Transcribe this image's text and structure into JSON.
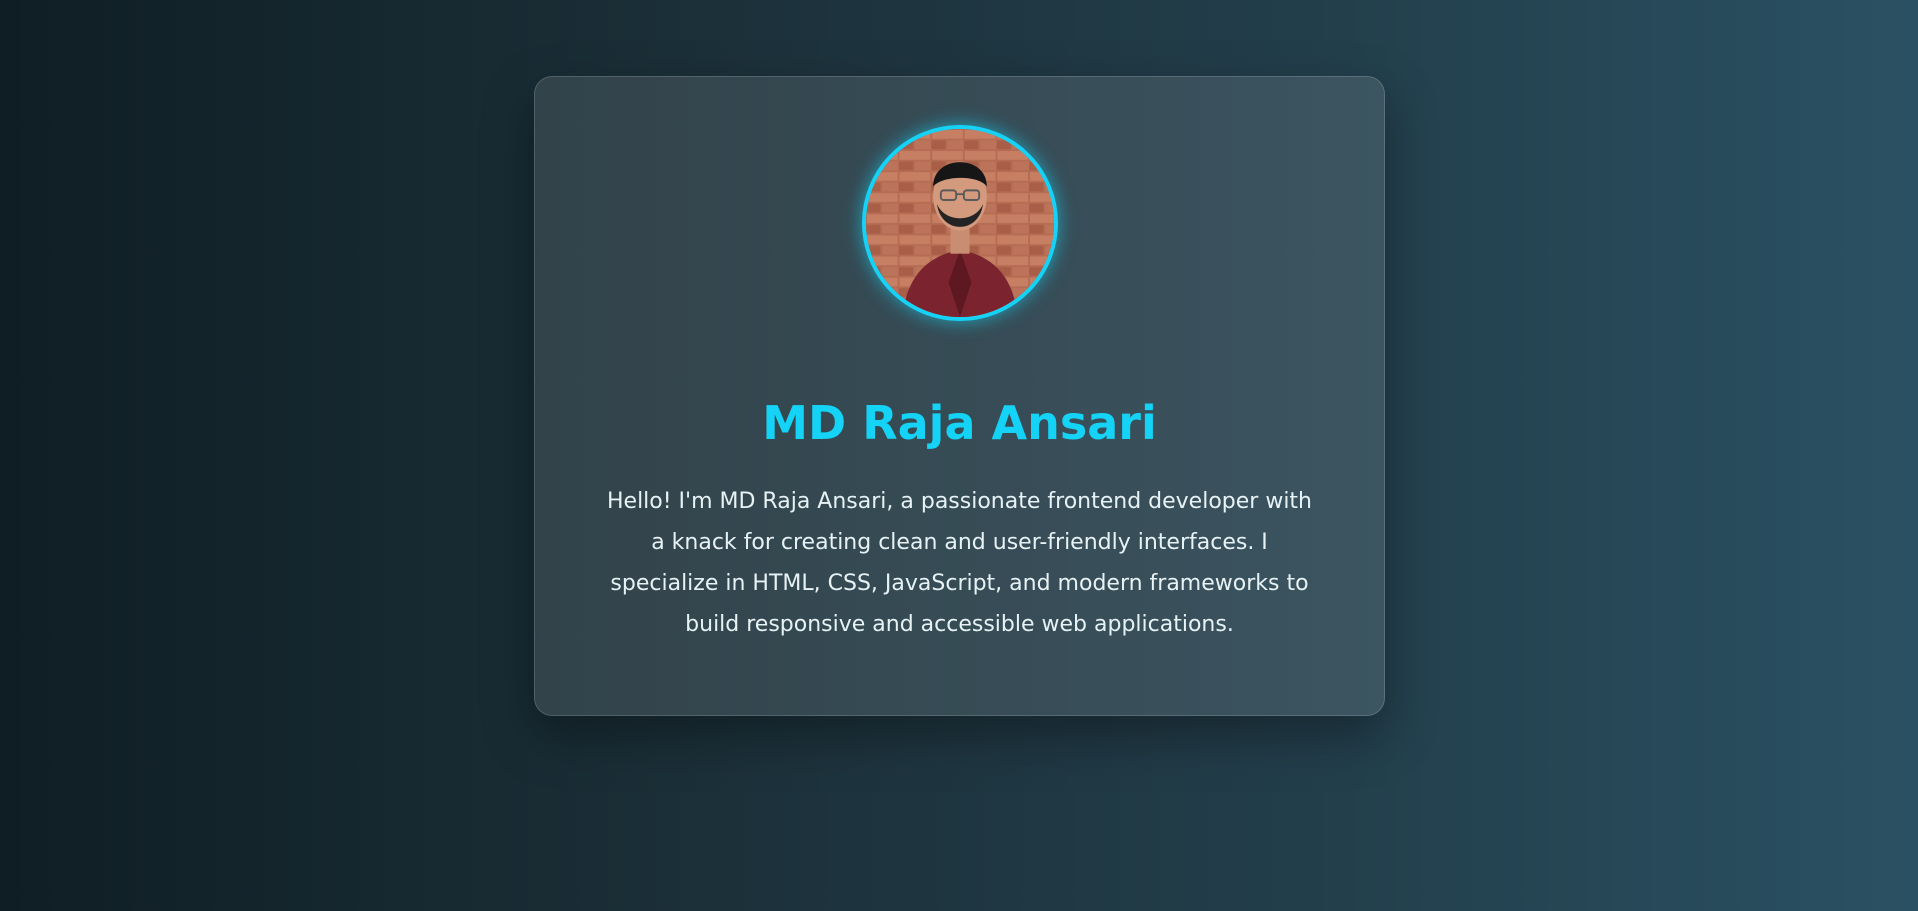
{
  "profile": {
    "avatar_icon": "profile-photo",
    "name": "MD Raja Ansari",
    "bio": "Hello! I'm MD Raja Ansari, a passionate frontend developer with a knack for creating clean and user-friendly interfaces. I specialize in HTML, CSS, JavaScript, and modern frameworks to build responsive and accessible web applications."
  },
  "theme": {
    "accent": "#16d2f6",
    "text": "#e7f2f5",
    "background_start": "#0f1e24",
    "background_end": "#2a5163"
  }
}
